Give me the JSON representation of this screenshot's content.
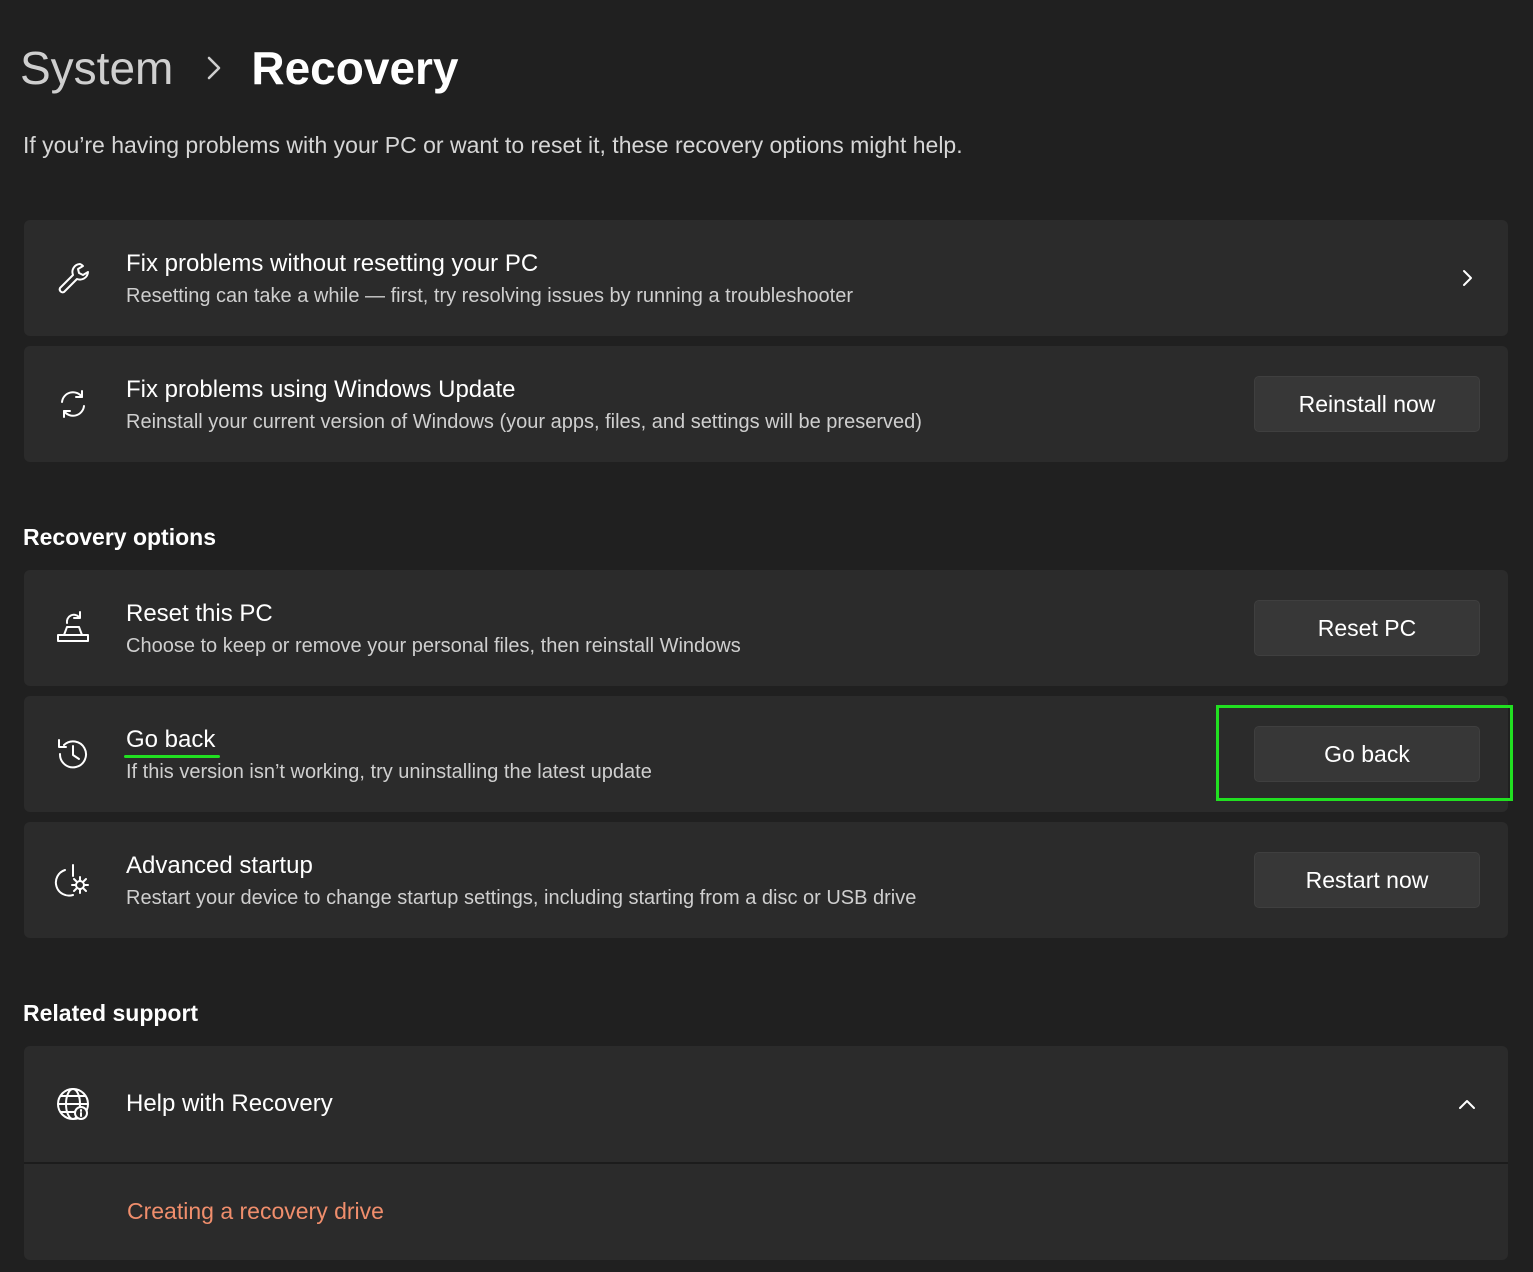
{
  "breadcrumb": {
    "parent": "System",
    "current": "Recovery"
  },
  "intro": "If you’re having problems with your PC or want to reset it, these recovery options might help.",
  "top_cards": [
    {
      "icon": "wrench-icon",
      "title": "Fix problems without resetting your PC",
      "subtitle": "Resetting can take a while — first, try resolving issues by running a troubleshooter",
      "action": "chevron-right-icon"
    },
    {
      "icon": "sync-icon",
      "title": "Fix problems using Windows Update",
      "subtitle": "Reinstall your current version of Windows (your apps, files, and settings will be preserved)",
      "button": "Reinstall now"
    }
  ],
  "recovery_options": {
    "heading": "Recovery options",
    "items": [
      {
        "icon": "reset-pc-icon",
        "title": "Reset this PC",
        "subtitle": "Choose to keep or remove your personal files, then reinstall Windows",
        "button": "Reset PC"
      },
      {
        "icon": "history-icon",
        "title": "Go back",
        "subtitle": "If this version isn’t working, try uninstalling the latest update",
        "button": "Go back"
      },
      {
        "icon": "advanced-startup-icon",
        "title": "Advanced startup",
        "subtitle": "Restart your device to change startup settings, including starting from a disc or USB drive",
        "button": "Restart now"
      }
    ]
  },
  "related_support": {
    "heading": "Related support",
    "help": {
      "icon": "globe-icon",
      "title": "Help with Recovery",
      "toggle": "chevron-up-icon",
      "link": "Creating a recovery drive"
    }
  },
  "colors": {
    "background": "#202020",
    "card": "#2b2b2b",
    "button": "#373737",
    "link": "#f08e6c",
    "highlight": "#21e021"
  }
}
